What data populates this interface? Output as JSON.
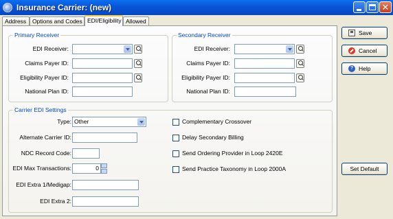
{
  "window": {
    "title": "Insurance Carrier: (new)"
  },
  "tabs": [
    {
      "label": "Address"
    },
    {
      "label": "Options and Codes"
    },
    {
      "label": "EDI/Eligibility"
    },
    {
      "label": "Allowed"
    }
  ],
  "primary": {
    "legend": "Primary Receiver",
    "edi_receiver_label": "EDI Receiver:",
    "edi_receiver_value": "",
    "claims_payer_label": "Claims Payer ID:",
    "claims_payer_value": "",
    "eligibility_payer_label": "Eligibility Payer ID:",
    "eligibility_payer_value": "",
    "national_plan_label": "National Plan ID:",
    "national_plan_value": ""
  },
  "secondary": {
    "legend": "Secondary Receiver",
    "edi_receiver_label": "EDI Receiver:",
    "edi_receiver_value": "",
    "claims_payer_label": "Claims Payer ID:",
    "claims_payer_value": "",
    "eligibility_payer_label": "Eligibility Payer ID:",
    "eligibility_payer_value": "",
    "national_plan_label": "National Plan ID:",
    "national_plan_value": ""
  },
  "carrier": {
    "legend": "Carrier EDI Settings",
    "type_label": "Type:",
    "type_value": "Other",
    "alt_carrier_label": "Alternate Carrier ID:",
    "alt_carrier_value": "",
    "ndc_label": "NDC Record Code:",
    "ndc_value": "",
    "max_tx_label": "EDI Max Transactions:",
    "max_tx_value": "0",
    "extra1_label": "EDI Extra 1/Medigap:",
    "extra1_value": "",
    "extra2_label": "EDI Extra 2:",
    "extra2_value": "",
    "checkboxes": [
      {
        "label": "Complementary Crossover",
        "checked": false
      },
      {
        "label": "Delay Secondary Billing",
        "checked": false
      },
      {
        "label": "Send Ordering Provider in Loop 2420E",
        "checked": false
      },
      {
        "label": "Send Practice Taxonomy in Loop 2000A",
        "checked": false
      }
    ]
  },
  "buttons": {
    "save": "Save",
    "cancel": "Cancel",
    "help": "Help",
    "help_icon": "?",
    "set_default": "Set Default"
  },
  "icons": {
    "title_buttons": [
      "minimize-icon",
      "maximize-icon",
      "close-icon"
    ],
    "lookup": "lookup-magnifier-icon"
  },
  "colors": {
    "title_bar": "#0a56d8",
    "group_legend": "#0046d5",
    "active_tab_accent": "#ffc83c"
  }
}
